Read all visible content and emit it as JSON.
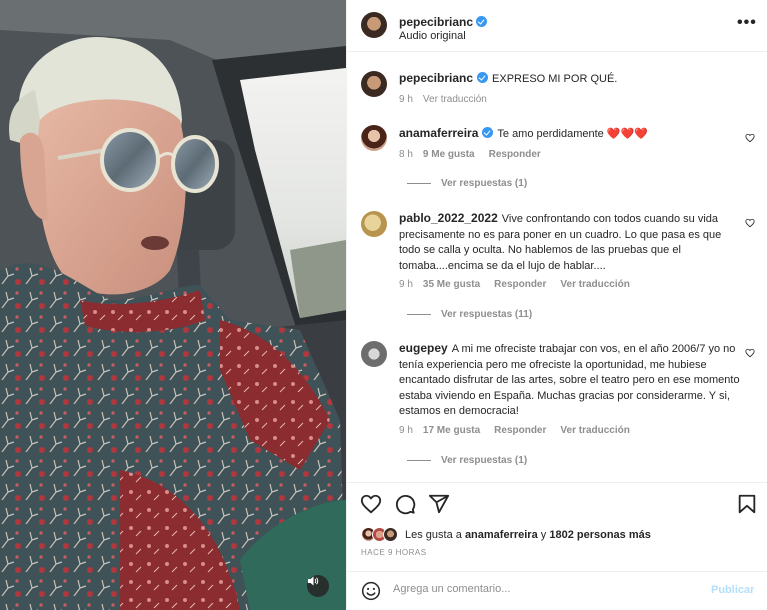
{
  "post": {
    "username": "pepecibrianc",
    "audio_label": "Audio original",
    "caption_user": "pepecibrianc",
    "caption_text": "EXPRESO MI POR QUÉ.",
    "caption_time": "9 h",
    "caption_translate": "Ver traducción"
  },
  "comments": [
    {
      "username": "anamaferreira",
      "verified": true,
      "text": "Te amo perdidamente ❤️❤️❤️",
      "time": "8 h",
      "likes": "9 Me gusta",
      "reply": "Responder",
      "translate": "",
      "view_replies": "Ver respuestas (1)"
    },
    {
      "username": "pablo_2022_2022",
      "verified": false,
      "text": "Vive confrontando con todos cuando su vida precisamente no es para poner en un cuadro. Lo que pasa es que todo se calla y oculta. No hablemos de las pruebas que el tomaba....encima se da el lujo de hablar....",
      "time": "9 h",
      "likes": "35 Me gusta",
      "reply": "Responder",
      "translate": "Ver traducción",
      "view_replies": "Ver respuestas (11)"
    },
    {
      "username": "eugepey",
      "verified": false,
      "text": "A mi me ofreciste trabajar con vos, en el año 2006/7 yo no tenía experiencia pero me ofreciste la oportunidad, me hubiese encantado disfrutar de las artes, sobre el teatro pero en ese momento estaba viviendo en España. Muchas gracias por considerarme. Y si, estamos en democracia!",
      "time": "9 h",
      "likes": "17 Me gusta",
      "reply": "Responder",
      "translate": "Ver traducción",
      "view_replies": "Ver respuestas (1)"
    }
  ],
  "likes": {
    "prefix": "Les gusta a ",
    "user": "anamaferreira",
    "middle": " y ",
    "count": "1802 personas más"
  },
  "time_ago": "HACE 9 HORAS",
  "comment_box": {
    "placeholder": "Agrega un comentario...",
    "post_label": "Publicar"
  },
  "icons": {
    "more": "more-icon",
    "like": "heart-icon",
    "comment": "comment-icon",
    "share": "share-icon",
    "save": "bookmark-icon",
    "emoji": "emoji-icon",
    "mute": "speaker-icon"
  },
  "colors": {
    "verified": "#3897f0",
    "secondary_text": "#8e8e8e",
    "heart_red": "#e0245e",
    "post_button_disabled": "#b2dffc"
  }
}
